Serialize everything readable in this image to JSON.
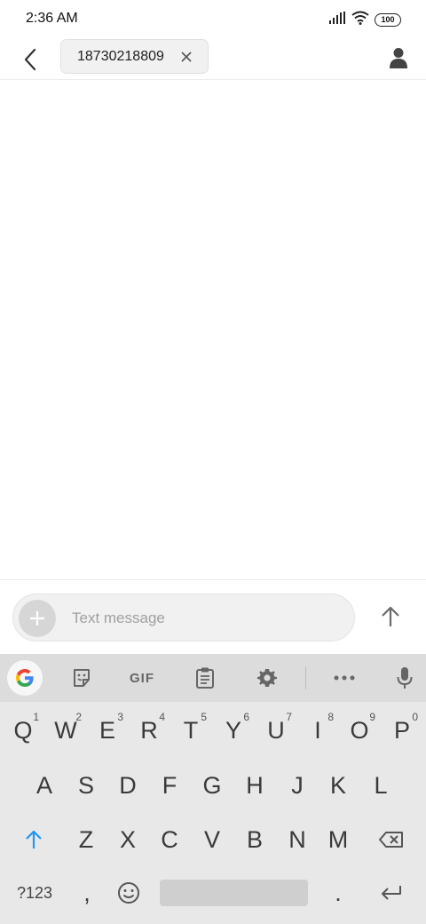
{
  "status_bar": {
    "time": "2:36 AM",
    "battery": "100"
  },
  "header": {
    "recipient": "18730218809"
  },
  "composer": {
    "placeholder": "Text message"
  },
  "keyboard": {
    "toolbar": {
      "gif_label": "GIF"
    },
    "row1": [
      {
        "key": "Q",
        "hint": "1"
      },
      {
        "key": "W",
        "hint": "2"
      },
      {
        "key": "E",
        "hint": "3"
      },
      {
        "key": "R",
        "hint": "4"
      },
      {
        "key": "T",
        "hint": "5"
      },
      {
        "key": "Y",
        "hint": "6"
      },
      {
        "key": "U",
        "hint": "7"
      },
      {
        "key": "I",
        "hint": "8"
      },
      {
        "key": "O",
        "hint": "9"
      },
      {
        "key": "P",
        "hint": "0"
      }
    ],
    "row2": [
      "A",
      "S",
      "D",
      "F",
      "G",
      "H",
      "J",
      "K",
      "L"
    ],
    "row3": [
      "Z",
      "X",
      "C",
      "V",
      "B",
      "N",
      "M"
    ],
    "row4": {
      "symbols_label": "?123",
      "comma": ",",
      "period": "."
    }
  }
}
